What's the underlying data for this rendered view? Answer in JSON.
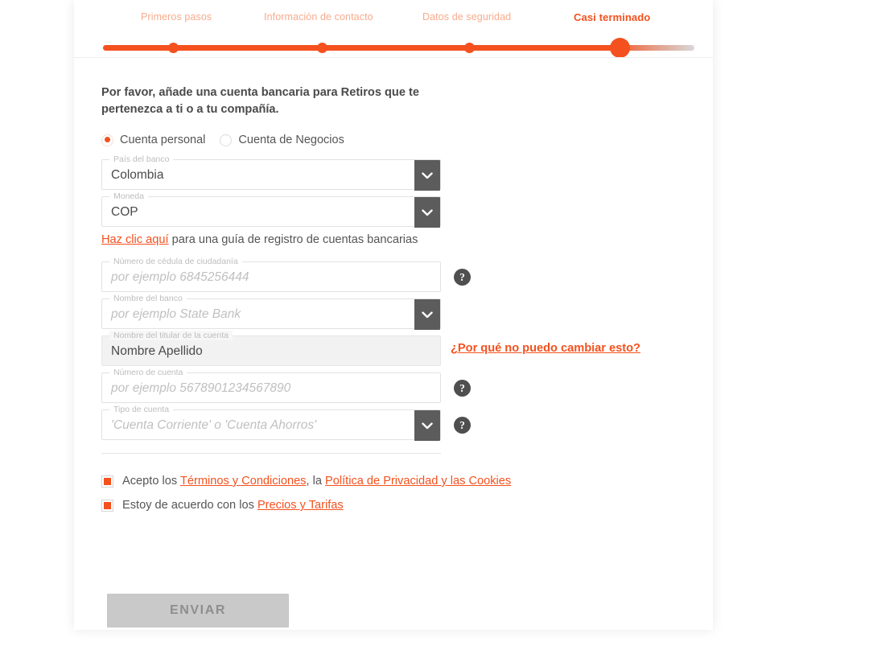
{
  "stepper": {
    "steps": [
      {
        "label": "Primeros pasos",
        "state": "completed"
      },
      {
        "label": "Información de contacto",
        "state": "completed"
      },
      {
        "label": "Datos de seguridad",
        "state": "completed"
      },
      {
        "label": "Casi terminado",
        "state": "active"
      }
    ],
    "accent_color": "#f4511e",
    "inactive_color": "#f8ab8d",
    "track_color": "#d8d8d8"
  },
  "headline": "Por favor, añade una cuenta bancaria para Retiros que te pertenezca a ti o a tu compañía.",
  "account_type": {
    "options": [
      {
        "label": "Cuenta personal",
        "selected": true
      },
      {
        "label": "Cuenta de Negocios",
        "selected": false
      }
    ]
  },
  "fields": {
    "bank_country": {
      "legend": "País del banco",
      "value": "Colombia",
      "control": "select"
    },
    "currency": {
      "legend": "Moneda",
      "value": "COP",
      "control": "select"
    },
    "guide_link": {
      "link_text": "Haz clic aquí",
      "rest_text": " para una guía de registro de cuentas bancarias"
    },
    "id_number": {
      "legend": "Número de cédula de ciudadanía",
      "placeholder": "por ejemplo 6845256444",
      "value": "",
      "control": "text",
      "help": "?"
    },
    "bank_name": {
      "legend": "Nombre del banco",
      "placeholder": "por ejemplo State Bank",
      "value": "",
      "control": "select"
    },
    "account_holder": {
      "legend": "Nombre del titular de la cuenta",
      "value": "Nombre Apellido",
      "control": "text",
      "disabled": true,
      "side_link": "¿Por qué no puedo cambiar esto?"
    },
    "account_number": {
      "legend": "Número de cuenta",
      "placeholder": "por ejemplo 5678901234567890",
      "value": "",
      "control": "text",
      "help": "?"
    },
    "account_kind": {
      "legend": "Tipo de cuenta",
      "placeholder": "'Cuenta Corriente' o 'Cuenta Ahorros'",
      "value": "",
      "control": "select",
      "help": "?"
    }
  },
  "consents": [
    {
      "checked": true,
      "prefix": "Acepto los ",
      "link1": "Términos y Condiciones",
      "middle": ", la ",
      "link2": "Política de Privacidad y las Cookies",
      "suffix": ""
    },
    {
      "checked": true,
      "prefix": "Estoy de acuerdo con los ",
      "link1": "Precios y Tarifas",
      "middle": "",
      "link2": "",
      "suffix": ""
    }
  ],
  "submit": {
    "label": "ENVIAR",
    "enabled": false
  }
}
